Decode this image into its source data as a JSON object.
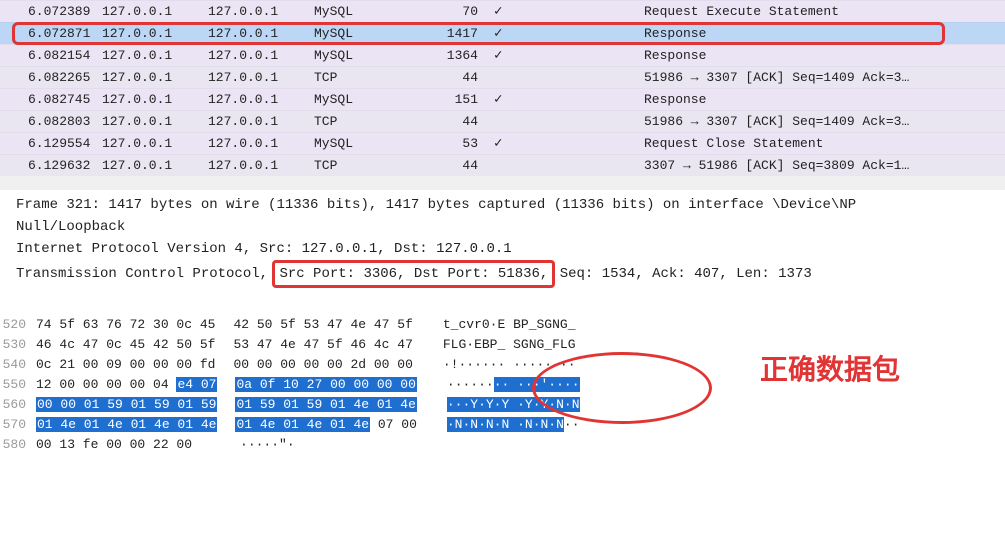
{
  "packet_list": [
    {
      "time": "6.072389",
      "src": "127.0.0.1",
      "dst": "127.0.0.1",
      "proto": "MySQL",
      "len": "70",
      "chk": "✓",
      "info": "Request Execute Statement",
      "cls": "",
      "hl": false
    },
    {
      "time": "6.072871",
      "src": "127.0.0.1",
      "dst": "127.0.0.1",
      "proto": "MySQL",
      "len": "1417",
      "chk": "✓",
      "info": "Response",
      "cls": "highlight",
      "hl": true
    },
    {
      "time": "6.082154",
      "src": "127.0.0.1",
      "dst": "127.0.0.1",
      "proto": "MySQL",
      "len": "1364",
      "chk": "✓",
      "info": "Response",
      "cls": "",
      "hl": false
    },
    {
      "time": "6.082265",
      "src": "127.0.0.1",
      "dst": "127.0.0.1",
      "proto": "TCP",
      "len": "44",
      "chk": "",
      "info": "51986 → 3307 [ACK] Seq=1409 Ack=3…",
      "cls": "tcp",
      "hl": false
    },
    {
      "time": "6.082745",
      "src": "127.0.0.1",
      "dst": "127.0.0.1",
      "proto": "MySQL",
      "len": "151",
      "chk": "✓",
      "info": "Response",
      "cls": "",
      "hl": false
    },
    {
      "time": "6.082803",
      "src": "127.0.0.1",
      "dst": "127.0.0.1",
      "proto": "TCP",
      "len": "44",
      "chk": "",
      "info": "51986 → 3307 [ACK] Seq=1409 Ack=3…",
      "cls": "tcp",
      "hl": false
    },
    {
      "time": "6.129554",
      "src": "127.0.0.1",
      "dst": "127.0.0.1",
      "proto": "MySQL",
      "len": "53",
      "chk": "✓",
      "info": "Request Close Statement",
      "cls": "",
      "hl": false
    },
    {
      "time": "6.129632",
      "src": "127.0.0.1",
      "dst": "127.0.0.1",
      "proto": "TCP",
      "len": "44",
      "chk": "",
      "info": "3307 → 51986 [ACK] Seq=3809 Ack=1…",
      "cls": "tcp",
      "hl": false
    }
  ],
  "detail": {
    "frame": "Frame 321: 1417 bytes on wire (11336 bits), 1417 bytes captured (11336 bits) on interface \\Device\\NP",
    "null": "Null/Loopback",
    "ipv4": "Internet Protocol Version 4, Src: 127.0.0.1, Dst: 127.0.0.1",
    "tcp_prefix": "Transmission Control Protocol,",
    "tcp_ports": " Src Port: 3306, Dst Port: 51836,",
    "tcp_suffix": " Seq: 1534, Ack: 407, Len: 1373"
  },
  "hex": [
    {
      "off": "520",
      "a": "74 5f 63 76 72 30 0c 45",
      "b": "42 50 5f 53 47 4e 47 5f",
      "sel_a": 0,
      "sel_b": 0,
      "ascii": "t_cvr0·E BP_SGNG_"
    },
    {
      "off": "530",
      "a": "46 4c 47 0c 45 42 50 5f",
      "b": "53 47 4e 47 5f 46 4c 47",
      "sel_a": 0,
      "sel_b": 0,
      "ascii": "FLG·EBP_ SGNG_FLG"
    },
    {
      "off": "540",
      "a": "0c 21 00 09 00 00 00 fd",
      "b": "00 00 00 00 00 2d 00 00",
      "sel_a": 0,
      "sel_b": 0,
      "ascii": "·!······ ·····-··"
    },
    {
      "off": "550",
      "a": "12 00 00 00 00 04",
      "a2": "e4 07",
      "b": "0a 0f 10 27 00 00 00 00",
      "sel_a": 2,
      "sel_b": 8,
      "ascii_pre": "······",
      "ascii_sel": "·· ···'····",
      "ascii_end": ""
    },
    {
      "off": "560",
      "a": "00 00 01 59 01 59 01 59",
      "b": "01 59 01 59 01 4e 01 4e",
      "sel_a": 8,
      "sel_b": 8,
      "ascii_pre": "",
      "ascii_sel": "···Y·Y·Y ·Y·Y·N·N",
      "ascii_end": ""
    },
    {
      "off": "570",
      "a": "01 4e 01 4e 01 4e 01 4e",
      "b": "01 4e 01 4e 01 4e",
      "b2": "07 00",
      "sel_a": 8,
      "sel_b": 6,
      "ascii_pre": "",
      "ascii_sel": "·N·N·N·N ·N·N·N",
      "ascii_end": "··"
    },
    {
      "off": "580",
      "a": "00 13 fe 00 00 22 00",
      "b": "",
      "sel_a": 0,
      "sel_b": 0,
      "ascii": "·····\"·"
    }
  ],
  "annotation": {
    "label": "正确数据包"
  }
}
